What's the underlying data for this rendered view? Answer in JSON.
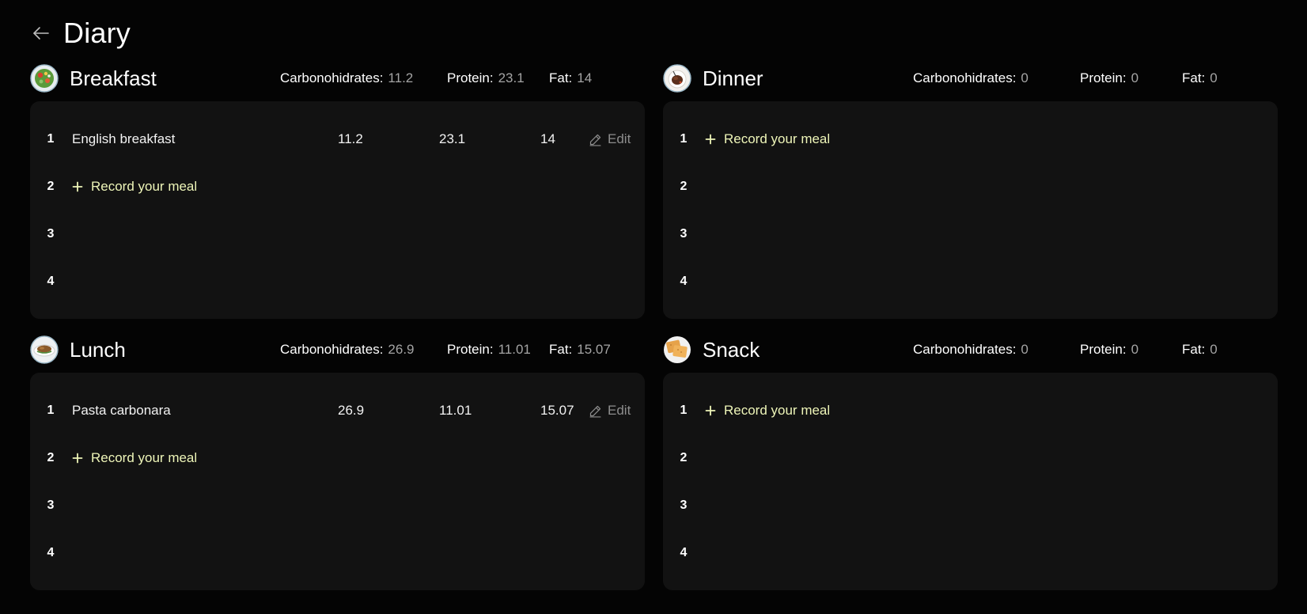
{
  "header": {
    "title": "Diary"
  },
  "labels": {
    "carbs": "Carbonohidrates:",
    "protein": "Protein:",
    "fat": "Fat:",
    "record": "Record your meal",
    "edit": "Edit"
  },
  "colors": {
    "background": "#040404",
    "card": "#121212",
    "accent": "#eef5b8",
    "muted": "#a4a4a4"
  },
  "meals": {
    "breakfast": {
      "title": "Breakfast",
      "icon": "salad-bowl-icon",
      "carbs": "11.2",
      "protein": "23.1",
      "fat": "14",
      "rows": [
        "1",
        "2",
        "3",
        "4"
      ],
      "entries": [
        {
          "name": "English breakfast",
          "carbs": "11.2",
          "protein": "23.1",
          "fat": "14"
        }
      ]
    },
    "dinner": {
      "title": "Dinner",
      "icon": "dinner-plate-icon",
      "carbs": "0",
      "protein": "0",
      "fat": "0",
      "rows": [
        "1",
        "2",
        "3",
        "4"
      ],
      "entries": []
    },
    "lunch": {
      "title": "Lunch",
      "icon": "lunch-plate-icon",
      "carbs": "26.9",
      "protein": "11.01",
      "fat": "15.07",
      "rows": [
        "1",
        "2",
        "3",
        "4"
      ],
      "entries": [
        {
          "name": "Pasta carbonara",
          "carbs": "26.9",
          "protein": "11.01",
          "fat": "15.07"
        }
      ]
    },
    "snack": {
      "title": "Snack",
      "icon": "snack-crackers-icon",
      "carbs": "0",
      "protein": "0",
      "fat": "0",
      "rows": [
        "1",
        "2",
        "3",
        "4"
      ],
      "entries": []
    }
  }
}
